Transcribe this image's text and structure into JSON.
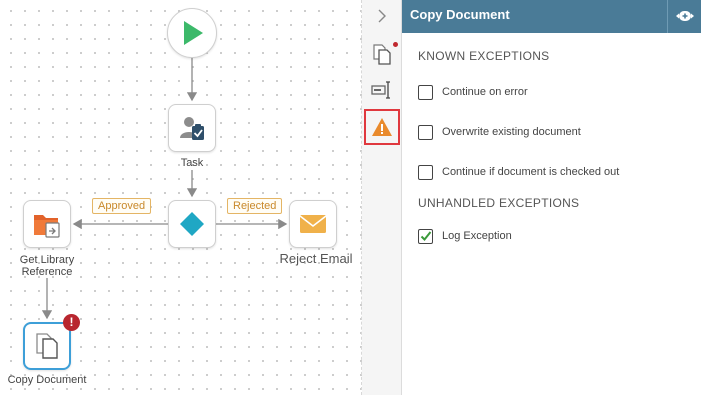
{
  "canvas": {
    "nodes": {
      "start": {
        "icon": "play-icon"
      },
      "task": {
        "label": "Task",
        "icon": "task-user-icon"
      },
      "decision": {
        "icon": "diamond-icon"
      },
      "get_library": {
        "label": "Get Library Reference",
        "icon": "folder-icon"
      },
      "reject_email": {
        "label": "Reject Email",
        "icon": "envelope-icon"
      },
      "copy_document": {
        "label": "Copy Document",
        "icon": "copy-document-icon",
        "error_badge": "!"
      }
    },
    "branches": {
      "approved": "Approved",
      "rejected": "Rejected"
    }
  },
  "tabstrip": {
    "collapse_icon": "chevron-right-icon",
    "tabs": [
      {
        "name": "properties",
        "icon": "document-pages-icon",
        "has_alert": true
      },
      {
        "name": "fields",
        "icon": "text-field-icon",
        "has_alert": false
      },
      {
        "name": "exceptions",
        "icon": "warning-icon",
        "has_alert": false,
        "active": true
      }
    ]
  },
  "panel": {
    "title": "Copy Document",
    "header_button_icon": "expand-arrows-icon",
    "known_exceptions": {
      "title": "KNOWN EXCEPTIONS",
      "options": [
        {
          "label": "Continue on error",
          "checked": false
        },
        {
          "label": "Overwrite existing document",
          "checked": false
        },
        {
          "label": "Continue if document is checked out",
          "checked": false
        }
      ]
    },
    "unhandled_exceptions": {
      "title": "UNHANDLED EXCEPTIONS",
      "options": [
        {
          "label": "Log Exception",
          "checked": true
        }
      ]
    }
  },
  "colors": {
    "header": "#4a7b97",
    "play_green": "#3cb96a",
    "decision_teal": "#1fa7c4",
    "folder_orange": "#e2622a",
    "envelope_gold": "#f0b14a",
    "error_red": "#b8262f",
    "highlight_red": "#e0383e",
    "check_green": "#3a9a3a",
    "branch_tag": "#e4b565"
  }
}
